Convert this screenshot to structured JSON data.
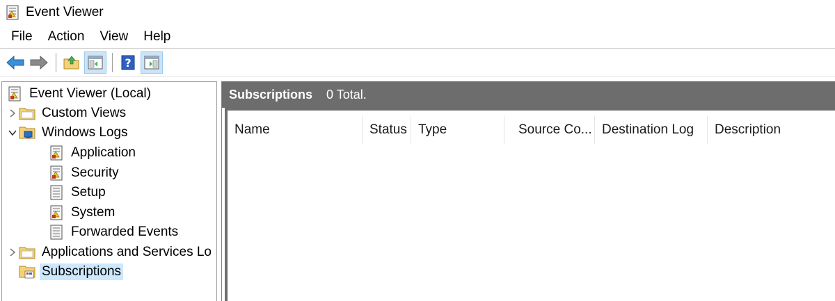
{
  "window": {
    "title": "Event Viewer"
  },
  "menu": [
    "File",
    "Action",
    "View",
    "Help"
  ],
  "toolbar": {
    "buttons": [
      "back-arrow-icon",
      "forward-arrow-icon",
      "open-folder-icon",
      "show-hide-tree-icon",
      "help-icon",
      "show-hide-action-pane-icon"
    ]
  },
  "tree": {
    "root": "Event Viewer (Local)",
    "custom_views": "Custom Views",
    "windows_logs": "Windows Logs",
    "application": "Application",
    "security": "Security",
    "setup": "Setup",
    "system": "System",
    "forwarded_events": "Forwarded Events",
    "apps_services": "Applications and Services Lo",
    "subscriptions": "Subscriptions"
  },
  "pane": {
    "title": "Subscriptions",
    "count": "0 Total."
  },
  "columns": [
    "Name",
    "Status",
    "Type",
    "Source Co...",
    "Destination Log",
    "Description"
  ],
  "colors": {
    "header_band": "#6d6d6d",
    "selection": "#cce8ff",
    "pressed_button": "#cce4f7"
  }
}
